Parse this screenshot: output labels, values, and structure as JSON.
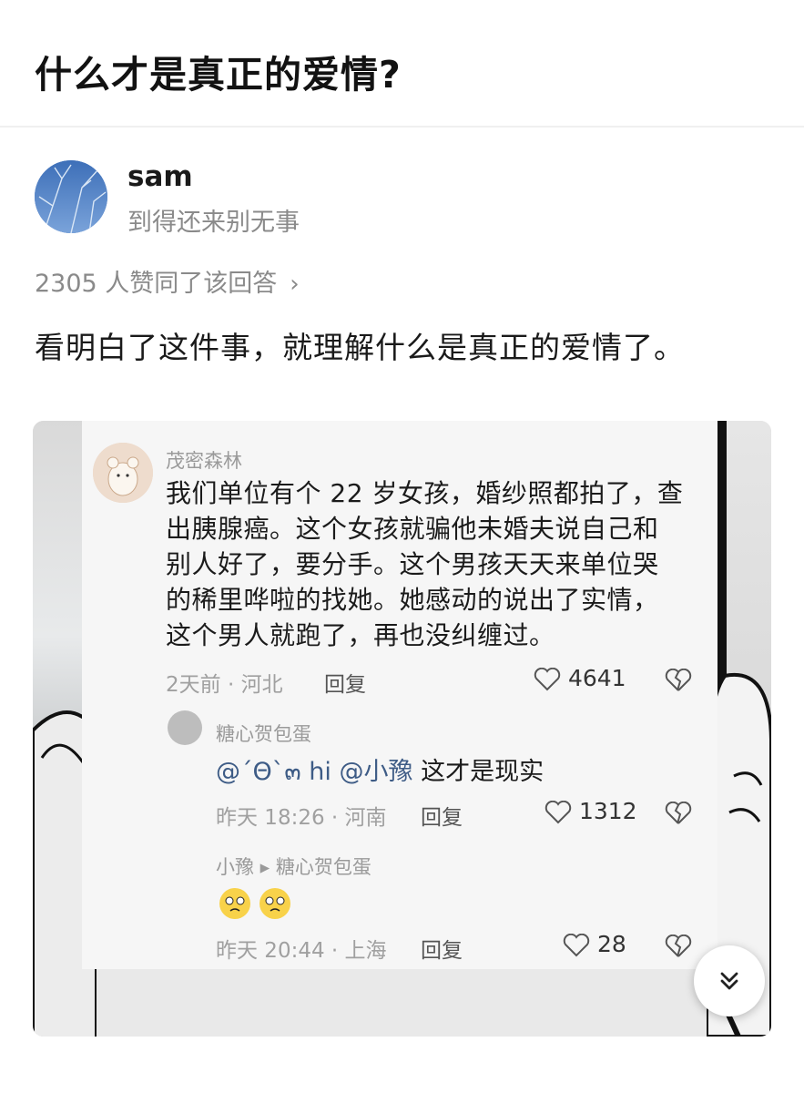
{
  "question": {
    "title": "什么才是真正的爱情?"
  },
  "author": {
    "name": "sam",
    "bio": "到得还来别无事"
  },
  "answer": {
    "likes_text": "2305 人赞同了该回答",
    "text": "看明白了这件事，就理解什么是真正的爱情了。"
  },
  "embedded_screenshot": {
    "main_comment": {
      "username": "茂密森林",
      "lines": [
        "我们单位有个 22 岁女孩，婚纱照都拍了，查",
        "出胰腺癌。这个女孩就骗他未婚夫说自己和",
        "别人好了，要分手。这个男孩天天来单位哭",
        "的稀里哗啦的找她。她感动的说出了实情，",
        "这个男人就跑了，再也没纠缠过。"
      ],
      "meta": "2天前 · 河北",
      "reply": "回复",
      "likes": "4641"
    },
    "reply_1": {
      "username": "糖心贺包蛋",
      "mention1": "@ˊΘˋ๓ hi",
      "mention2": "@小豫",
      "text": " 这才是现实",
      "meta": "昨天 18:26 · 河南",
      "reply": "回复",
      "likes": "1312"
    },
    "reply_2": {
      "username": "小豫 ▸ 糖心贺包蛋",
      "meta": "昨天 20:44 · 上海",
      "reply": "回复",
      "likes": "28"
    }
  },
  "icons": [
    "chevron-right-icon",
    "heart-icon",
    "broken-heart-icon",
    "double-chevron-down-icon"
  ]
}
